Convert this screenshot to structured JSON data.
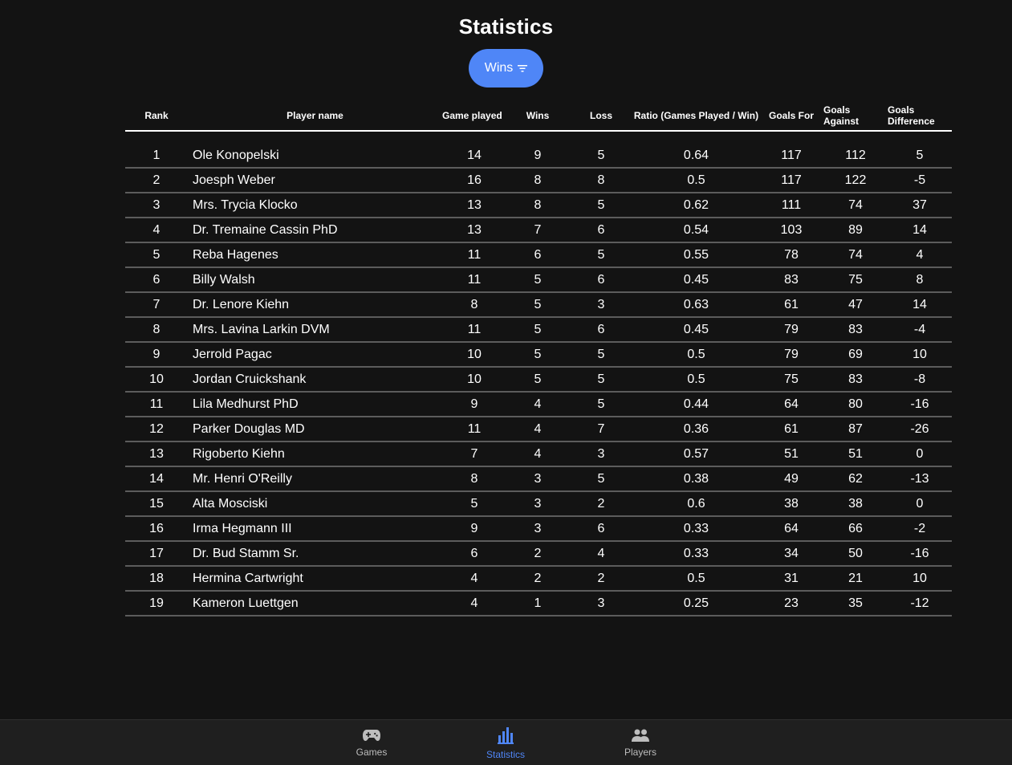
{
  "page": {
    "title": "Statistics"
  },
  "sort_button": {
    "label": "Wins",
    "icon": "filter-list-icon",
    "color": "#4f86f7"
  },
  "table": {
    "headers": {
      "rank": "Rank",
      "player_name": "Player name",
      "game_played": "Game played",
      "wins": "Wins",
      "loss": "Loss",
      "ratio": "Ratio (Games Played / Win)",
      "goals_for": "Goals For",
      "goals_against": "Goals Against",
      "goals_difference": "Goals Difference"
    },
    "rows": [
      {
        "rank": "1",
        "name": "Ole Konopelski",
        "played": "14",
        "wins": "9",
        "loss": "5",
        "ratio": "0.64",
        "gf": "117",
        "ga": "112",
        "gd": "5"
      },
      {
        "rank": "2",
        "name": "Joesph Weber",
        "played": "16",
        "wins": "8",
        "loss": "8",
        "ratio": "0.5",
        "gf": "117",
        "ga": "122",
        "gd": "-5"
      },
      {
        "rank": "3",
        "name": "Mrs. Trycia Klocko",
        "played": "13",
        "wins": "8",
        "loss": "5",
        "ratio": "0.62",
        "gf": "111",
        "ga": "74",
        "gd": "37"
      },
      {
        "rank": "4",
        "name": "Dr. Tremaine Cassin PhD",
        "played": "13",
        "wins": "7",
        "loss": "6",
        "ratio": "0.54",
        "gf": "103",
        "ga": "89",
        "gd": "14"
      },
      {
        "rank": "5",
        "name": "Reba Hagenes",
        "played": "11",
        "wins": "6",
        "loss": "5",
        "ratio": "0.55",
        "gf": "78",
        "ga": "74",
        "gd": "4"
      },
      {
        "rank": "6",
        "name": "Billy Walsh",
        "played": "11",
        "wins": "5",
        "loss": "6",
        "ratio": "0.45",
        "gf": "83",
        "ga": "75",
        "gd": "8"
      },
      {
        "rank": "7",
        "name": "Dr. Lenore Kiehn",
        "played": "8",
        "wins": "5",
        "loss": "3",
        "ratio": "0.63",
        "gf": "61",
        "ga": "47",
        "gd": "14"
      },
      {
        "rank": "8",
        "name": "Mrs. Lavina Larkin DVM",
        "played": "11",
        "wins": "5",
        "loss": "6",
        "ratio": "0.45",
        "gf": "79",
        "ga": "83",
        "gd": "-4"
      },
      {
        "rank": "9",
        "name": "Jerrold Pagac",
        "played": "10",
        "wins": "5",
        "loss": "5",
        "ratio": "0.5",
        "gf": "79",
        "ga": "69",
        "gd": "10"
      },
      {
        "rank": "10",
        "name": "Jordan Cruickshank",
        "played": "10",
        "wins": "5",
        "loss": "5",
        "ratio": "0.5",
        "gf": "75",
        "ga": "83",
        "gd": "-8"
      },
      {
        "rank": "11",
        "name": "Lila Medhurst PhD",
        "played": "9",
        "wins": "4",
        "loss": "5",
        "ratio": "0.44",
        "gf": "64",
        "ga": "80",
        "gd": "-16"
      },
      {
        "rank": "12",
        "name": "Parker Douglas MD",
        "played": "11",
        "wins": "4",
        "loss": "7",
        "ratio": "0.36",
        "gf": "61",
        "ga": "87",
        "gd": "-26"
      },
      {
        "rank": "13",
        "name": "Rigoberto Kiehn",
        "played": "7",
        "wins": "4",
        "loss": "3",
        "ratio": "0.57",
        "gf": "51",
        "ga": "51",
        "gd": "0"
      },
      {
        "rank": "14",
        "name": "Mr. Henri O'Reilly",
        "played": "8",
        "wins": "3",
        "loss": "5",
        "ratio": "0.38",
        "gf": "49",
        "ga": "62",
        "gd": "-13"
      },
      {
        "rank": "15",
        "name": "Alta Mosciski",
        "played": "5",
        "wins": "3",
        "loss": "2",
        "ratio": "0.6",
        "gf": "38",
        "ga": "38",
        "gd": "0"
      },
      {
        "rank": "16",
        "name": "Irma Hegmann III",
        "played": "9",
        "wins": "3",
        "loss": "6",
        "ratio": "0.33",
        "gf": "64",
        "ga": "66",
        "gd": "-2"
      },
      {
        "rank": "17",
        "name": "Dr. Bud Stamm Sr.",
        "played": "6",
        "wins": "2",
        "loss": "4",
        "ratio": "0.33",
        "gf": "34",
        "ga": "50",
        "gd": "-16"
      },
      {
        "rank": "18",
        "name": "Hermina Cartwright",
        "played": "4",
        "wins": "2",
        "loss": "2",
        "ratio": "0.5",
        "gf": "31",
        "ga": "21",
        "gd": "10"
      },
      {
        "rank": "19",
        "name": "Kameron Luettgen",
        "played": "4",
        "wins": "1",
        "loss": "3",
        "ratio": "0.25",
        "gf": "23",
        "ga": "35",
        "gd": "-12"
      }
    ]
  },
  "bottom_nav": {
    "items": [
      {
        "label": "Games",
        "icon": "gamepad-icon",
        "active": false
      },
      {
        "label": "Statistics",
        "icon": "bar-chart-icon",
        "active": true
      },
      {
        "label": "Players",
        "icon": "people-icon",
        "active": false
      }
    ],
    "active_color": "#4f86f7",
    "inactive_color": "#bdbdbd"
  }
}
